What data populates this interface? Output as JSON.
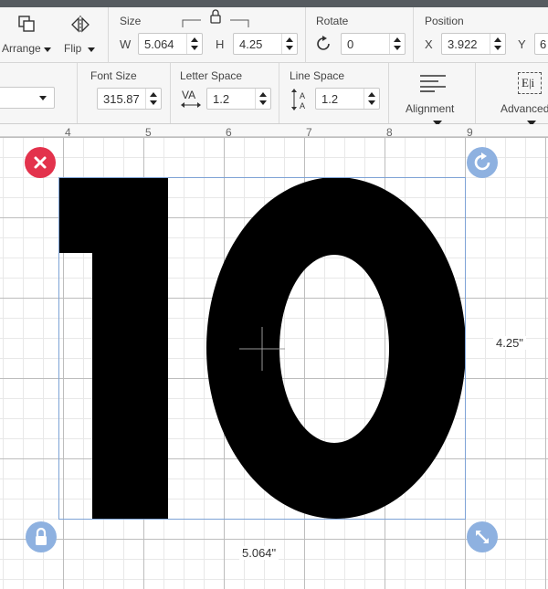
{
  "toolbar1": {
    "arrange_label": "Arrange",
    "flip_label": "Flip",
    "size_label": "Size",
    "w_label": "W",
    "w_value": "5.064",
    "h_label": "H",
    "h_value": "4.25",
    "rotate_label": "Rotate",
    "rotate_value": "0",
    "position_label": "Position",
    "x_label": "X",
    "x_value": "3.922",
    "y_label": "Y",
    "y_value": "6"
  },
  "toolbar2": {
    "font_size_label": "Font Size",
    "font_size_value": "315.87",
    "letter_space_label": "Letter Space",
    "letter_space_value": "1.2",
    "line_space_label": "Line Space",
    "line_space_value": "1.2",
    "alignment_label": "Alignment",
    "advanced_label": "Advanced",
    "va_glyph": "VA",
    "ei_glyph": "E|i"
  },
  "ruler": [
    "4",
    "5",
    "6",
    "7",
    "8",
    "9"
  ],
  "canvas": {
    "text_content": "10",
    "height_dim": "4.25\"",
    "width_dim": "5.064\""
  },
  "colors": {
    "delete_handle": "#e3324c",
    "action_handle": "#8eb1e0",
    "selection_border": "#7ea3d6"
  }
}
